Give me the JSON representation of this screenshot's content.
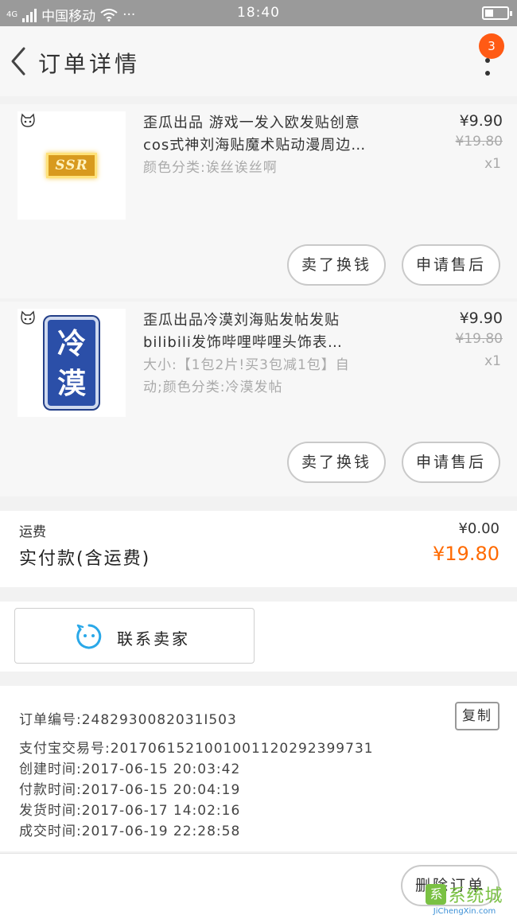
{
  "status_bar": {
    "signal_label": "4G",
    "carrier": "中国移动",
    "more": "···",
    "time": "18:40"
  },
  "nav": {
    "title": "订单详情",
    "badge_count": "3"
  },
  "items": [
    {
      "name_line1": "歪瓜出品 游戏一发入欧发贴创意",
      "name_line2": "cos式神刘海贴魔术贴动漫周边…",
      "spec_line1": "颜色分类:诶丝诶丝啊",
      "spec_line2": "",
      "thumb_text": "SSR",
      "price": "¥9.90",
      "old_price": "¥19.80",
      "qty": "x1",
      "btn_resell": "卖了换钱",
      "btn_aftersale": "申请售后"
    },
    {
      "name_line1": "歪瓜出品冷漠刘海贴发帖发贴",
      "name_line2": "bilibili发饰哔哩哔哩头饰表…",
      "spec_line1": "大小:【1包2片!买3包减1包】自",
      "spec_line2": "动;颜色分类:冷漠发帖",
      "thumb_text": "冷漠",
      "price": "¥9.90",
      "old_price": "¥19.80",
      "qty": "x1",
      "btn_resell": "卖了换钱",
      "btn_aftersale": "申请售后"
    }
  ],
  "summary": {
    "shipping_label": "运费",
    "shipping_value": "¥0.00",
    "paid_label": "实付款(含运费)",
    "paid_value": "¥19.80"
  },
  "contact": {
    "label": "联系卖家"
  },
  "order_info": {
    "order_no": "订单编号:2482930082031I503",
    "alipay_no": "支付宝交易号:2017061521001001120292399731",
    "created": "创建时间:2017-06-15 20:03:42",
    "paid": "付款时间:2017-06-15 20:04:19",
    "shipped": "发货时间:2017-06-17 14:02:16",
    "completed": "成交时间:2017-06-19 22:28:58",
    "copy_label": "复制"
  },
  "bottom": {
    "delete_label": "删除订单"
  },
  "watermark": {
    "text": "系统城",
    "url": "JiChengXin.com"
  },
  "colors": {
    "accent_orange": "#ff6a00",
    "badge_orange": "#ff5a14",
    "status_bar": "#9a9a9a",
    "contact_icon": "#2aa8e8"
  }
}
